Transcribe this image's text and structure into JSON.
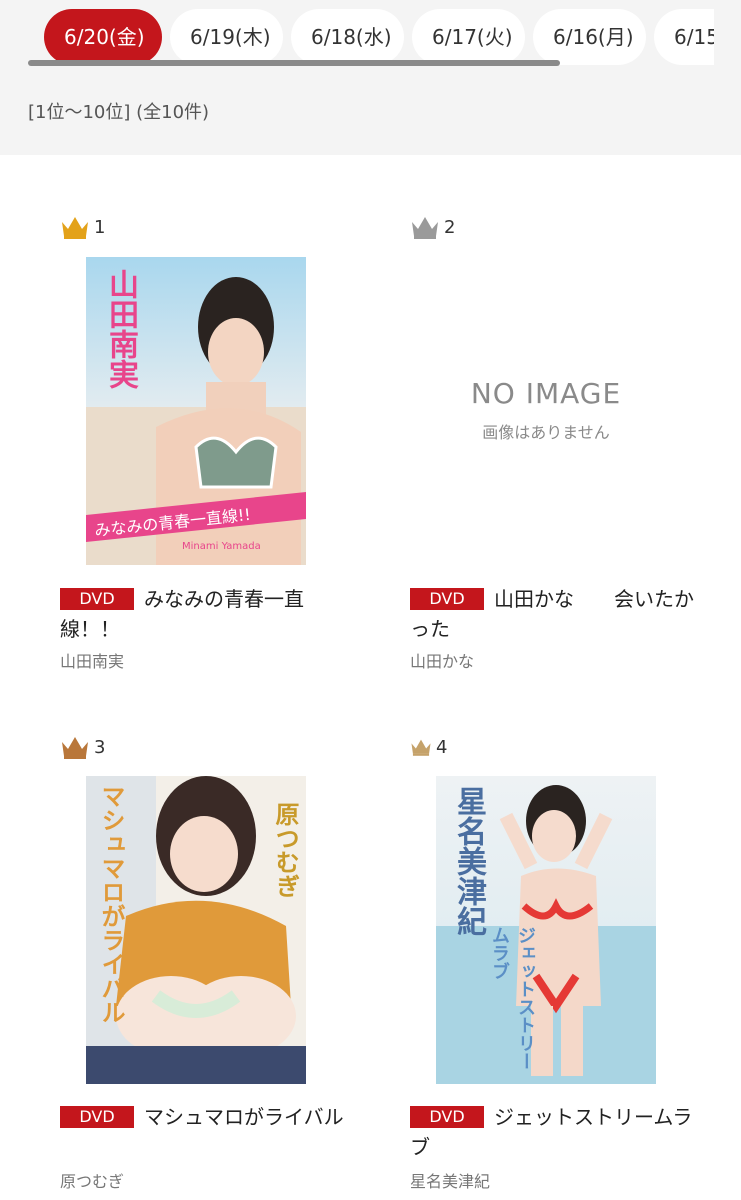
{
  "tabs": [
    "6/20(金)",
    "6/19(木)",
    "6/18(水)",
    "6/17(火)",
    "6/16(月)",
    "6/15"
  ],
  "range_text": "[1位〜10位] (全10件)",
  "colors": {
    "accent": "#c4161c",
    "gold": "#e3a21a",
    "silver": "#9a9a9a",
    "bronze": "#b9773a"
  },
  "items": [
    {
      "rank": "1",
      "format": "DVD",
      "title": "みなみの青春一直線！！",
      "artist": "山田南実",
      "crown": "gold-crown-icon",
      "cover": {
        "vertical_text": "山田南実",
        "banner": "みなみの青春一直線!!",
        "sub": "Minami Yamada"
      }
    },
    {
      "rank": "2",
      "format": "DVD",
      "title": "山田かな　　会いたかった",
      "artist": "山田かな",
      "crown": "silver-crown-icon",
      "noimage": {
        "title": "NO IMAGE",
        "subtitle": "画像はありません"
      }
    },
    {
      "rank": "3",
      "format": "DVD",
      "title": "マシュマロがライバル",
      "artist": "原つむぎ",
      "crown": "bronze-crown-icon",
      "cover": {
        "vertical_text": "原つむぎ",
        "banner": "マシュマロがライバル"
      }
    },
    {
      "rank": "4",
      "format": "DVD",
      "title": "ジェットストリームラブ",
      "artist": "星名美津紀",
      "crown": "small-crown-icon",
      "cover": {
        "vertical_text": "星名美津紀",
        "banner": "ジェットストリームラブ"
      }
    }
  ]
}
